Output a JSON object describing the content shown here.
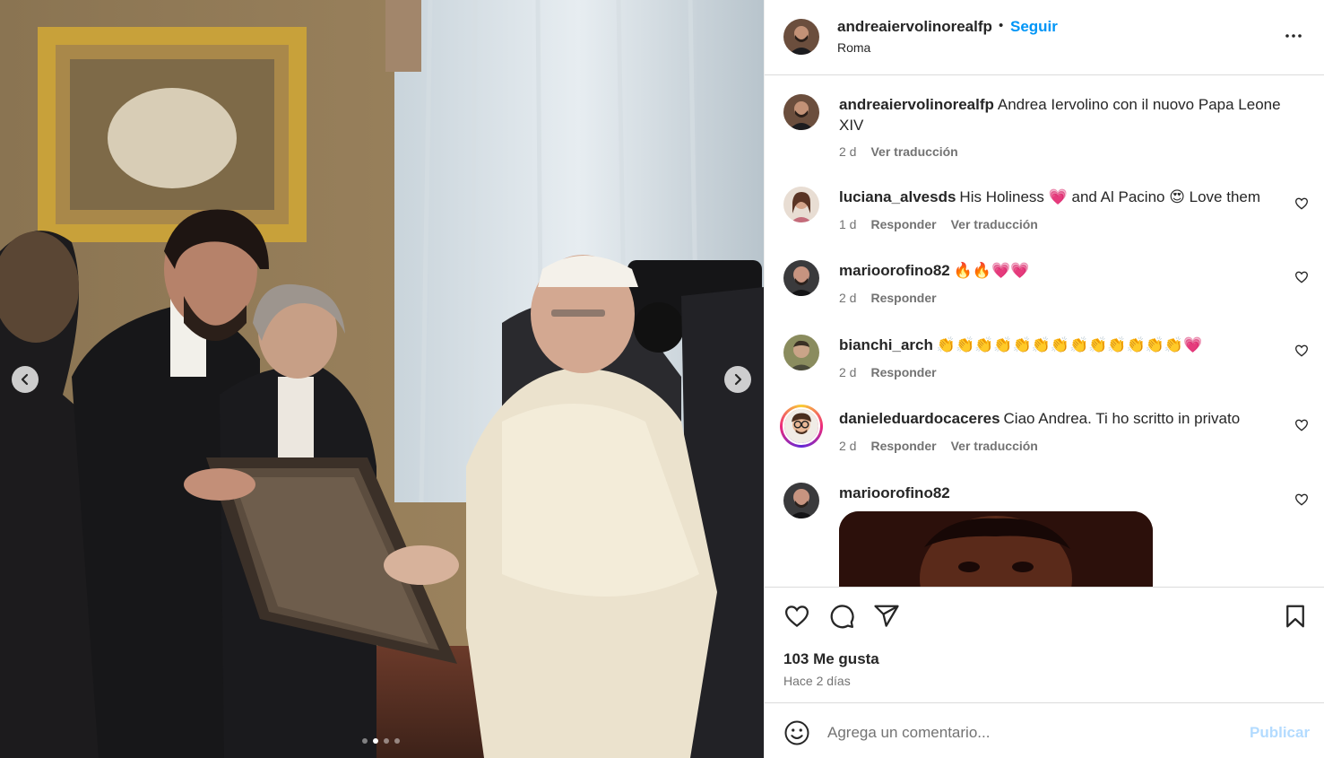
{
  "post": {
    "owner": "andreaiervolinorealfp",
    "separator": "•",
    "follow_label": "Seguir",
    "location": "Roma",
    "more_icon": "more-horizontal-icon",
    "carousel": {
      "total_slides": 4,
      "active_slide": 2
    }
  },
  "caption": {
    "user": "andreaiervolinorealfp",
    "text": "Andrea Iervolino con il nuovo Papa Leone XIV",
    "time": "2 d",
    "translate": "Ver traducción"
  },
  "comments": [
    {
      "user": "luciana_alvesds",
      "text": "His Holiness 💗 and Al Pacino 😍 Love them",
      "time": "1 d",
      "reply": "Responder",
      "translate": "Ver traducción"
    },
    {
      "user": "marioorofino82",
      "text": "🔥🔥💗💗",
      "time": "2 d",
      "reply": "Responder",
      "translate": ""
    },
    {
      "user": "bianchi_arch",
      "text": "👏👏👏👏👏👏👏👏👏👏👏👏👏💗",
      "time": "2 d",
      "reply": "Responder",
      "translate": ""
    },
    {
      "user": "danieleduardocaceres",
      "text": "Ciao Andrea. Ti ho scritto in privato",
      "time": "2 d",
      "reply": "Responder",
      "translate": "Ver traducción"
    },
    {
      "user": "marioorofino82",
      "text": "",
      "time": "",
      "reply": "",
      "translate": ""
    }
  ],
  "actions": {
    "likes": "103 Me gusta",
    "date": "Hace 2 días"
  },
  "composer": {
    "placeholder": "Agrega un comentario...",
    "publish": "Publicar"
  },
  "colors": {
    "accent": "#0095f6",
    "publish_disabled": "#b3dbff",
    "secondary_text": "#737373"
  }
}
